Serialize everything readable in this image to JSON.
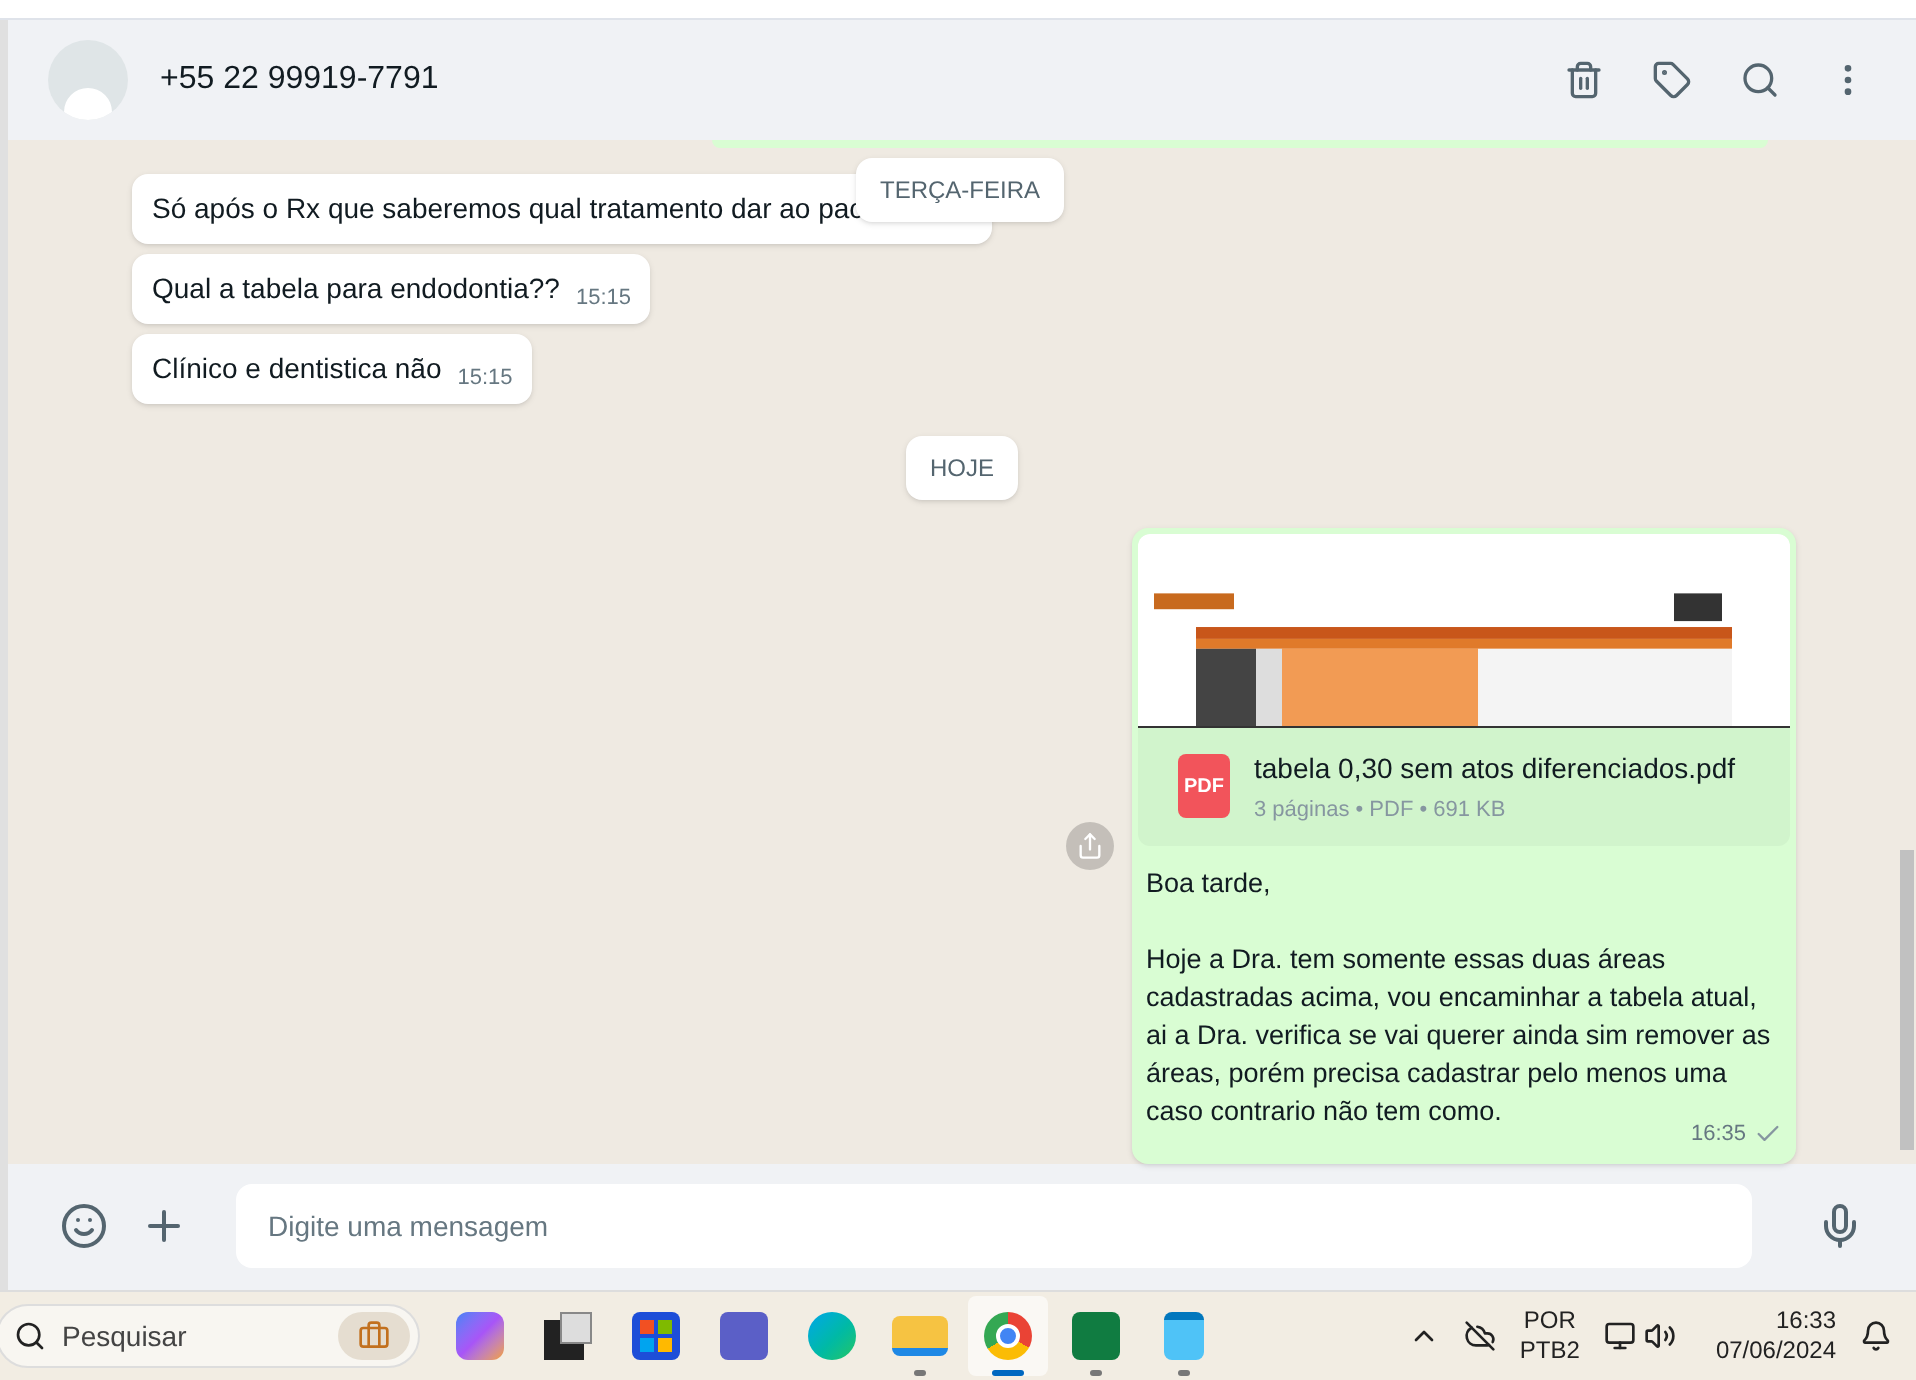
{
  "header": {
    "contact": "+55 22 99919-7791"
  },
  "messages": [
    {
      "text": "Só após o Rx que saberemos qual tratamento dar ao pac"
    },
    {
      "text": "Qual a tabela para endodontia??",
      "time": "15:15"
    },
    {
      "text": "Clínico e dentistica não",
      "time": "15:15"
    }
  ],
  "day_labels": [
    "TERÇA-FEIRA",
    "HOJE"
  ],
  "outgoing": {
    "file_name": "tabela 0,30 sem atos diferenciados.pdf",
    "badge": "PDF",
    "meta": "3 páginas • PDF • 691 KB",
    "paragraphs": [
      "Boa tarde,",
      "Hoje a Dra. tem somente essas duas áreas cadastradas acima, vou encaminhar a tabela atual, ai a Dra. verifica se vai querer ainda sim remover as áreas, porém precisa cadastrar pelo menos uma caso contrario não tem como."
    ],
    "time": "16:35",
    "delivered": false
  },
  "composer": {
    "placeholder": "Digite uma mensagem"
  },
  "taskbar": {
    "search_placeholder": "Pesquisar",
    "apps": [
      {
        "kind": "copilot",
        "selected": false,
        "running": false
      },
      {
        "kind": "tasks",
        "selected": false,
        "running": false
      },
      {
        "kind": "store",
        "selected": false,
        "running": false
      },
      {
        "kind": "teams",
        "selected": false,
        "running": false
      },
      {
        "kind": "edge",
        "selected": false,
        "running": false
      },
      {
        "kind": "files",
        "selected": false,
        "running": true
      },
      {
        "kind": "chrome",
        "selected": true,
        "running": true
      },
      {
        "kind": "excel",
        "selected": false,
        "running": true
      },
      {
        "kind": "notepad",
        "selected": false,
        "running": true
      }
    ],
    "language": "POR",
    "layout": "PTB2",
    "time": "16:33",
    "date": "07/06/2024"
  }
}
